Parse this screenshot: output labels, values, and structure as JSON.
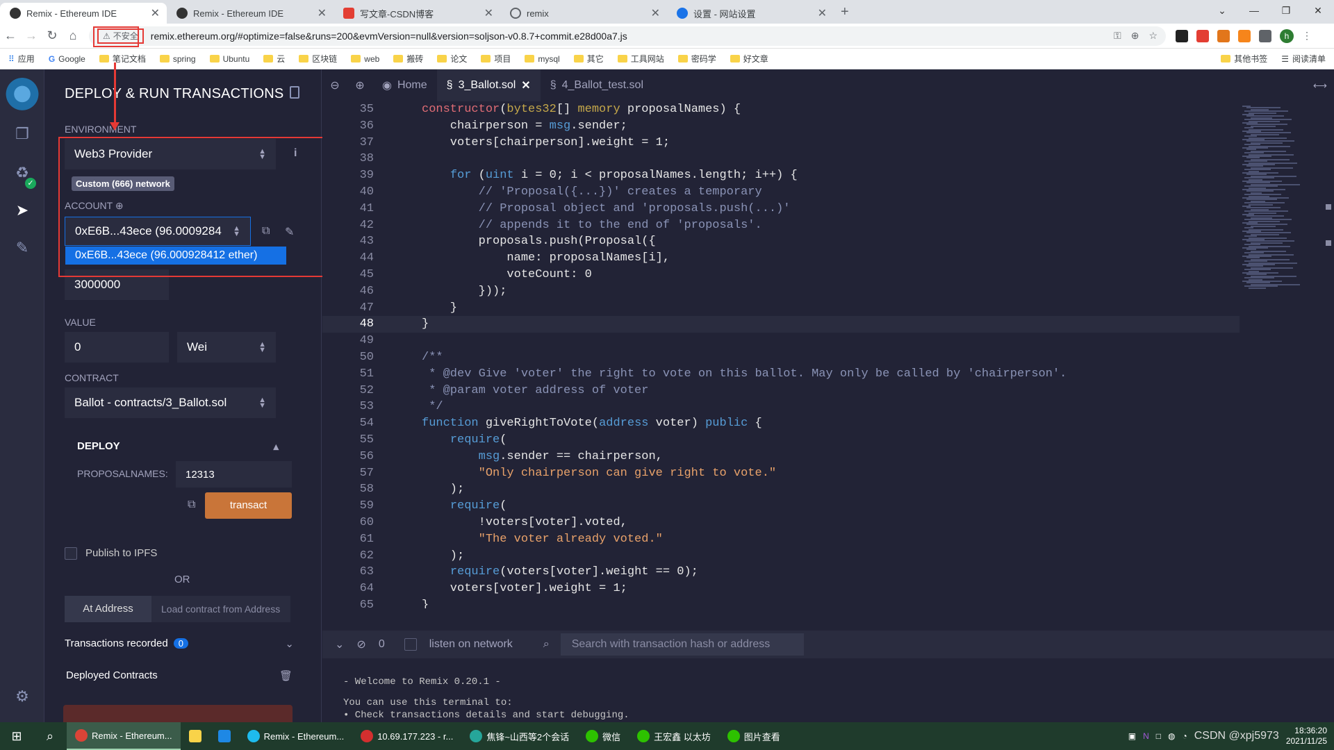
{
  "browser": {
    "tabs": [
      {
        "title": "Remix - Ethereum IDE",
        "active": true
      },
      {
        "title": "Remix - Ethereum IDE",
        "active": false
      },
      {
        "title": "写文章-CSDN博客",
        "active": false
      },
      {
        "title": "remix",
        "active": false
      },
      {
        "title": "设置 - 网站设置",
        "active": false
      }
    ],
    "insecure_label": "不安全",
    "url": "remix.ethereum.org/#optimize=false&runs=200&evmVersion=null&version=soljson-v0.8.7+commit.e28d00a7.js",
    "profile_initial": "h",
    "bookmarks": [
      "应用",
      "Google",
      "笔记文档",
      "spring",
      "Ubuntu",
      "云",
      "区块链",
      "web",
      "搬砖",
      "论文",
      "项目",
      "mysql",
      "其它",
      "工具网站",
      "密码学",
      "好文章"
    ],
    "bookmarks_right": [
      "其他书签",
      "阅读清单"
    ]
  },
  "deploy": {
    "title": "DEPLOY & RUN TRANSACTIONS",
    "environment_label": "ENVIRONMENT",
    "environment_value": "Web3 Provider",
    "network_badge": "Custom (666) network",
    "account_label": "ACCOUNT",
    "account_value": "0xE6B...43ece (96.0009284",
    "account_option": "0xE6B...43ece (96.000928412 ether)",
    "gas_limit_value": "3000000",
    "value_label": "VALUE",
    "value_amount": "0",
    "value_unit": "Wei",
    "contract_label": "CONTRACT",
    "contract_value": "Ballot - contracts/3_Ballot.sol",
    "deploy_label": "DEPLOY",
    "proposalnames_label": "PROPOSALNAMES:",
    "proposalnames_value": "12313",
    "transact_label": "transact",
    "publish_label": "Publish to IPFS",
    "or_label": "OR",
    "at_address_label": "At Address",
    "load_placeholder": "Load contract from Address",
    "transactions_recorded_label": "Transactions recorded",
    "transactions_count": "0",
    "deployed_contracts_label": "Deployed Contracts"
  },
  "editor": {
    "tabs": [
      {
        "label": "Home",
        "active": false
      },
      {
        "label": "3_Ballot.sol",
        "active": true
      },
      {
        "label": "4_Ballot_test.sol",
        "active": false
      }
    ],
    "current_line": 48,
    "lines": [
      {
        "n": "35",
        "html": "<span class='kw2'>constructor</span>(<span class='t'>bytes32</span>[] <span class='t'>memory</span> proposalNames) {"
      },
      {
        "n": "36",
        "html": "    chairperson = <span class='k'>msg</span>.sender;"
      },
      {
        "n": "37",
        "html": "    voters[chairperson].weight = 1;"
      },
      {
        "n": "38",
        "html": ""
      },
      {
        "n": "39",
        "html": "    <span class='k'>for</span> (<span class='k'>uint</span> i = 0; i &lt; proposalNames.length; i++) {"
      },
      {
        "n": "40",
        "html": "        <span class='c'>// 'Proposal({...})' creates a temporary</span>"
      },
      {
        "n": "41",
        "html": "        <span class='c'>// Proposal object and 'proposals.push(...)'</span>"
      },
      {
        "n": "42",
        "html": "        <span class='c'>// appends it to the end of 'proposals'.</span>"
      },
      {
        "n": "43",
        "html": "        proposals.push(Proposal({"
      },
      {
        "n": "44",
        "html": "            name: proposalNames[i],"
      },
      {
        "n": "45",
        "html": "            voteCount: 0"
      },
      {
        "n": "46",
        "html": "        }));"
      },
      {
        "n": "47",
        "html": "    }"
      },
      {
        "n": "48",
        "html": "}"
      },
      {
        "n": "49",
        "html": ""
      },
      {
        "n": "50",
        "html": "<span class='c'>/**</span>"
      },
      {
        "n": "51",
        "html": "<span class='c'> * @dev Give 'voter' the right to vote on this ballot. May only be called by 'chairperson'.</span>"
      },
      {
        "n": "52",
        "html": "<span class='c'> * @param voter address of voter</span>"
      },
      {
        "n": "53",
        "html": "<span class='c'> */</span>"
      },
      {
        "n": "54",
        "html": "<span class='k'>function</span> giveRightToVote(<span class='k'>address</span> voter) <span class='k'>public</span> {"
      },
      {
        "n": "55",
        "html": "    <span class='k'>require</span>("
      },
      {
        "n": "56",
        "html": "        <span class='k'>msg</span>.sender == chairperson,"
      },
      {
        "n": "57",
        "html": "        <span class='s'>\"Only chairperson can give right to vote.\"</span>"
      },
      {
        "n": "58",
        "html": "    );"
      },
      {
        "n": "59",
        "html": "    <span class='k'>require</span>("
      },
      {
        "n": "60",
        "html": "        !voters[voter].voted,"
      },
      {
        "n": "61",
        "html": "        <span class='s'>\"The voter already voted.\"</span>"
      },
      {
        "n": "62",
        "html": "    );"
      },
      {
        "n": "63",
        "html": "    <span class='k'>require</span>(voters[voter].weight == 0);"
      },
      {
        "n": "64",
        "html": "    voters[voter].weight = 1;"
      },
      {
        "n": "65",
        "html": "}"
      }
    ]
  },
  "terminal": {
    "count": "0",
    "listen_label": "listen on network",
    "search_placeholder": "Search with transaction hash or address",
    "welcome": "- Welcome to Remix 0.20.1 -",
    "line2": "You can use this terminal to:",
    "line3": "• Check transactions details and start debugging."
  },
  "taskbar": {
    "items": [
      "Remix - Ethereum...",
      "",
      "",
      "Remix - Ethereum...",
      "10.69.177.223 - r...",
      "焦锋~山西等2个会话",
      "微信",
      "王宏鑫 以太坊",
      "图片查看"
    ],
    "watermark": "CSDN @xpj5973",
    "time": "18:36:20",
    "date": "2021/11/25"
  }
}
